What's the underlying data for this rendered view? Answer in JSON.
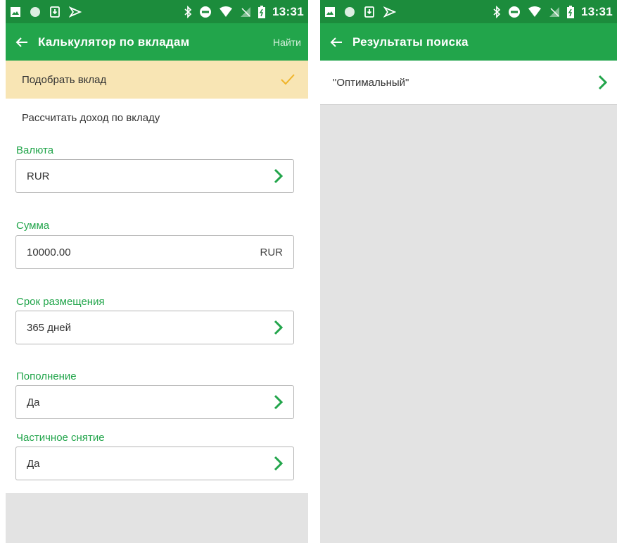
{
  "status_bar": {
    "time": "13:31"
  },
  "left": {
    "title": "Калькулятор по вкладам",
    "action": "Найти",
    "modes": [
      {
        "label": "Подобрать вклад",
        "selected": true
      },
      {
        "label": "Рассчитать доход по вкладу",
        "selected": false
      }
    ],
    "fields": {
      "currency": {
        "label": "Валюта",
        "value": "RUR"
      },
      "amount": {
        "label": "Сумма",
        "value": "10000.00",
        "unit": "RUR"
      },
      "term": {
        "label": "Срок размещения",
        "value": "365 дней"
      },
      "topup": {
        "label": "Пополнение",
        "value": "Да"
      },
      "withdrawal": {
        "label": "Частичное снятие",
        "value": "Да"
      }
    }
  },
  "right": {
    "title": "Результаты поиска",
    "results": [
      {
        "label": "\"Оптимальный\""
      }
    ]
  },
  "colors": {
    "status_bar": "#1c8c3c",
    "app_bar": "#22a54b",
    "accent": "#22a54b",
    "selected_row": "#f8e5b4",
    "check": "#f0b429",
    "background": "#e3e3e3"
  },
  "icons": [
    "image-icon",
    "circle-icon",
    "download-icon",
    "cast-icon",
    "bluetooth-icon",
    "dnd-icon",
    "wifi-icon",
    "no-signal-icon",
    "battery-icon",
    "back-arrow-icon",
    "check-icon",
    "chevron-right-icon"
  ]
}
